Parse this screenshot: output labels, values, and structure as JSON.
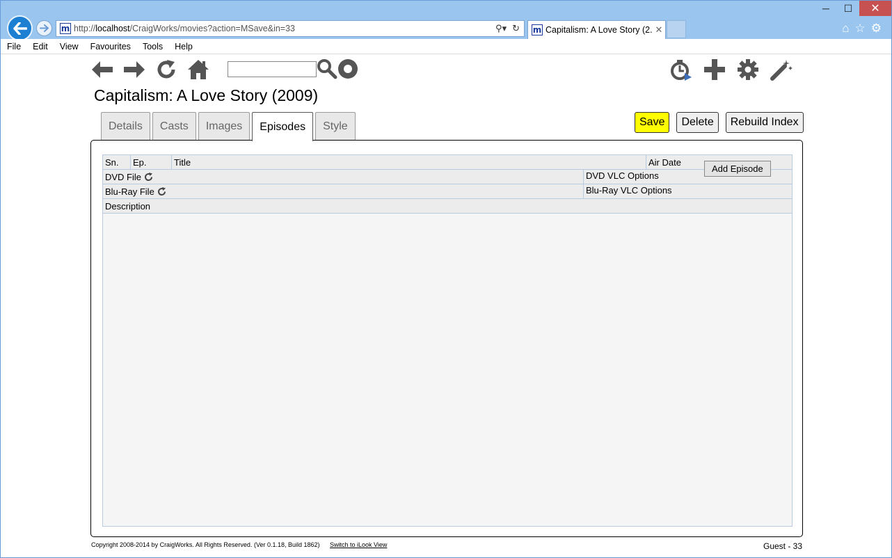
{
  "browser": {
    "url_prefix": "http://",
    "url_host": "localhost",
    "url_path": "/CraigWorks/movies?action=MSave&in=33",
    "tab_title": "Capitalism: A Love Story (2...",
    "favicon_letter": "m"
  },
  "menu": [
    "File",
    "Edit",
    "View",
    "Favourites",
    "Tools",
    "Help"
  ],
  "page": {
    "title": "Capitalism: A Love Story (2009)",
    "search_value": ""
  },
  "tabs": [
    "Details",
    "Casts",
    "Images",
    "Episodes",
    "Style"
  ],
  "active_tab": "Episodes",
  "actions": {
    "save": "Save",
    "delete": "Delete",
    "rebuild": "Rebuild Index"
  },
  "grid": {
    "headers": {
      "sn": "Sn.",
      "ep": "Ep.",
      "title": "Title",
      "air_date": "Air Date"
    },
    "dvd_file": "DVD File",
    "dvd_vlc": "DVD VLC Options",
    "bluray_file": "Blu-Ray File",
    "bluray_vlc": "Blu-Ray VLC Options",
    "description": "Description",
    "add_episode": "Add Episode"
  },
  "footer": {
    "copyright": "Copyright 2008-2014 by CraigWorks. All Rights Reserved. (Ver 0.1.18, Build 1862)",
    "switch_link": "Switch to iLook View",
    "user": "Guest - 33"
  },
  "colors": {
    "titlebar": "#99c5ef",
    "save_button": "#ffff00",
    "icon_gray": "#555555",
    "close_button": "#c75050"
  }
}
